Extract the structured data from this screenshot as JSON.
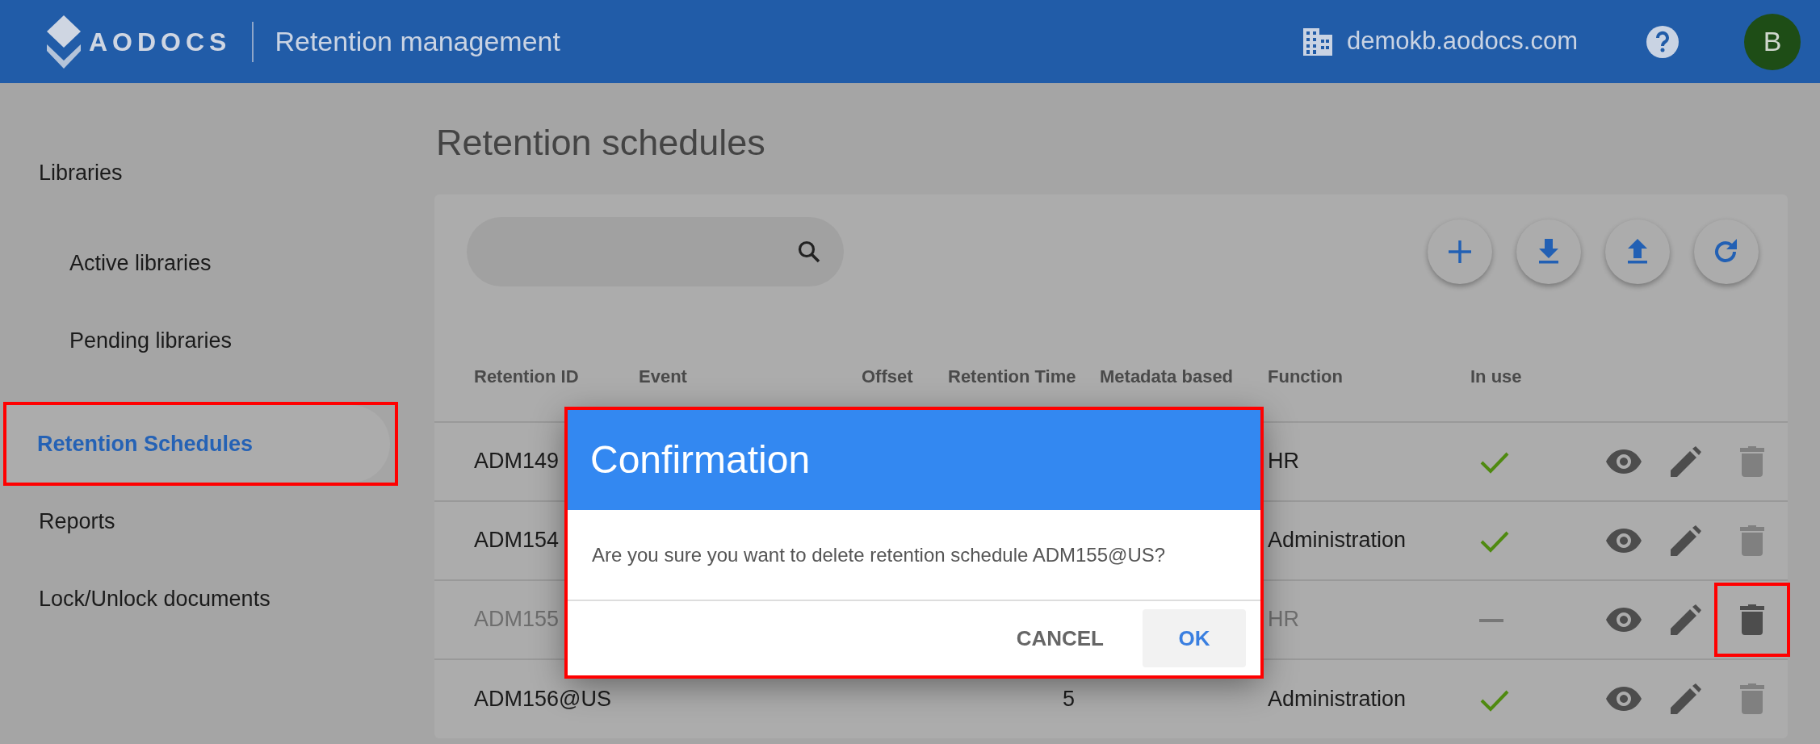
{
  "header": {
    "logo_text": "AODOCS",
    "app_title": "Retention management",
    "domain": "demokb.aodocs.com",
    "avatar_letter": "B"
  },
  "sidebar": {
    "items": [
      {
        "label": "Libraries",
        "selected": false,
        "highlighted": false,
        "children": [
          {
            "label": "Active libraries",
            "selected": false,
            "highlighted": false
          },
          {
            "label": "Pending libraries",
            "selected": false,
            "highlighted": false
          }
        ]
      },
      {
        "label": "Retention Schedules",
        "selected": true,
        "highlighted": true
      },
      {
        "label": "Reports",
        "selected": false,
        "highlighted": false
      },
      {
        "label": "Lock/Unlock documents",
        "selected": false,
        "highlighted": false
      }
    ]
  },
  "page_title": "Retention schedules",
  "toolbar": {
    "actions": [
      {
        "kind": "add"
      },
      {
        "kind": "download"
      },
      {
        "kind": "upload"
      },
      {
        "kind": "refresh"
      }
    ]
  },
  "table": {
    "columns": [
      "Retention ID",
      "Event",
      "Offset",
      "Retention Time",
      "Metadata based",
      "Function",
      "In use"
    ],
    "rows": [
      {
        "retention_id": "ADM149",
        "function": "HR",
        "in_use": true,
        "disabled": false,
        "delete_enabled": false,
        "delete_highlighted": false
      },
      {
        "retention_id": "ADM154",
        "function": "Administration",
        "in_use": true,
        "disabled": false,
        "delete_enabled": false,
        "delete_highlighted": false
      },
      {
        "retention_id": "ADM155",
        "function": "HR",
        "in_use": false,
        "disabled": true,
        "delete_enabled": true,
        "delete_highlighted": true
      },
      {
        "retention_id": "ADM156@US",
        "retention_time": "5",
        "function": "Administration",
        "in_use": true,
        "disabled": false,
        "delete_enabled": false,
        "delete_highlighted": false
      }
    ]
  },
  "dialog": {
    "title": "Confirmation",
    "message": "Are you sure you want to delete retention schedule ADM155@US?",
    "highlighted": true,
    "buttons": [
      {
        "label": "CANCEL",
        "kind": "text"
      },
      {
        "label": "OK",
        "kind": "filled"
      }
    ]
  }
}
